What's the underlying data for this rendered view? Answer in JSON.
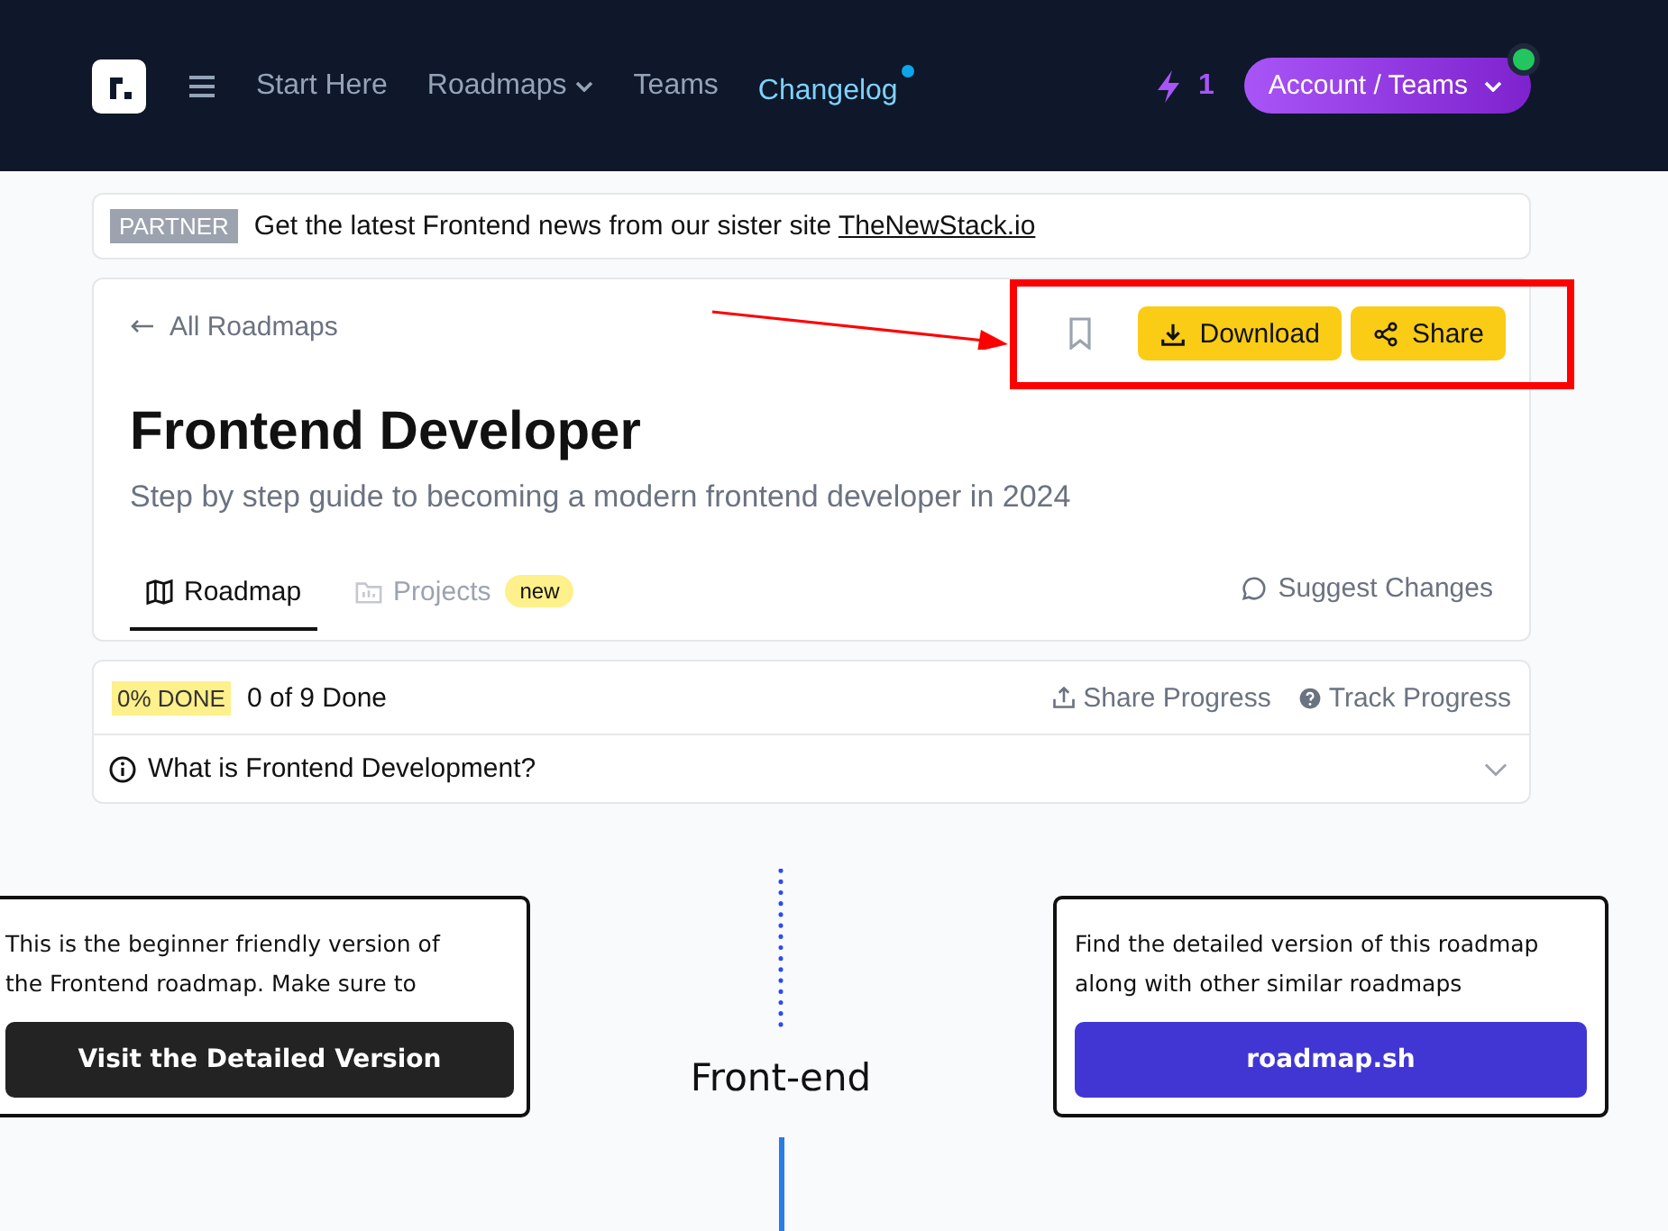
{
  "nav": {
    "items": [
      {
        "label": "Start Here",
        "dropdown": false,
        "highlighted": false,
        "dot": false
      },
      {
        "label": "Roadmaps",
        "dropdown": true,
        "highlighted": false,
        "dot": false
      },
      {
        "label": "Teams",
        "dropdown": false,
        "highlighted": false,
        "dot": false
      },
      {
        "label": "Changelog",
        "dropdown": false,
        "highlighted": true,
        "dot": true
      }
    ],
    "streak": "1",
    "account": "Account / Teams",
    "online": true
  },
  "partner": {
    "badge": "PARTNER",
    "text": "Get the latest Frontend news from our sister site ",
    "link": "TheNewStack.io"
  },
  "header": {
    "back": "All Roadmaps",
    "actions": [
      "Download",
      "Share"
    ],
    "title": "Frontend Developer",
    "subtitle": "Step by step guide to becoming a modern frontend developer in 2024",
    "tabs": [
      {
        "label": "Roadmap",
        "selected": true
      },
      {
        "label": "Projects",
        "selected": false,
        "badge": "new"
      }
    ],
    "suggest": "Suggest Changes"
  },
  "progress": {
    "badge": "0% DONE",
    "done": "0 of 9 Done",
    "share": "Share Progress",
    "track": "Track Progress",
    "faq": "What is Frontend Development?",
    "expanded": false
  },
  "roadmap": {
    "left_note": {
      "text": "This is the beginner friendly version of the Frontend roadmap. Make sure to",
      "button": "Visit the Detailed Version"
    },
    "center": "Front-end",
    "right_note": {
      "text": "Find the detailed version of this roadmap along with other similar roadmaps",
      "button": "roadmap.sh"
    }
  }
}
